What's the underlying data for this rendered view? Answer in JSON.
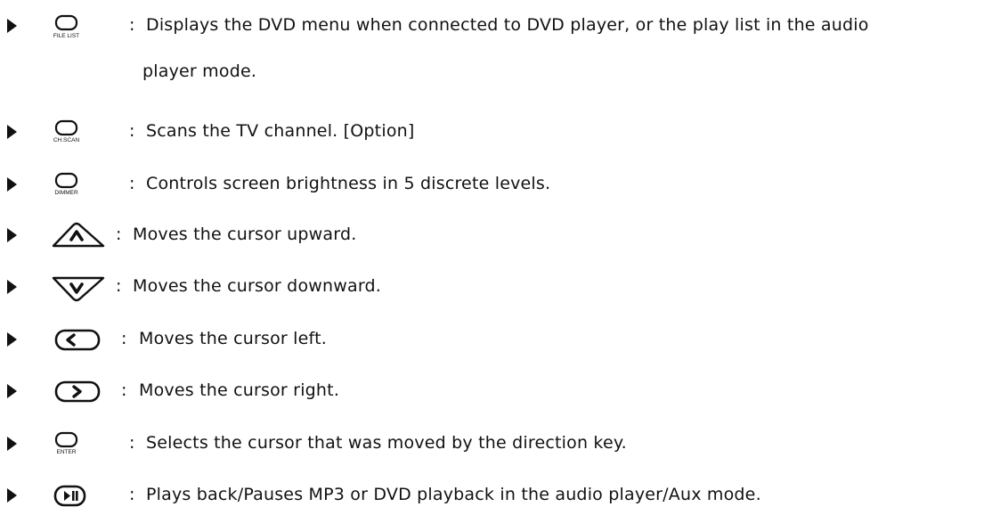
{
  "items": [
    {
      "icon": "file-list-button-icon",
      "key_label": "FILE LIST",
      "line1": "Displays the DVD menu when connected to DVD player, or the play list in the audio",
      "line2": "player mode."
    },
    {
      "icon": "ch-scan-button-icon",
      "key_label": "CH.SCAN",
      "line1": "Scans the TV channel. [Option]"
    },
    {
      "icon": "dimmer-button-icon",
      "key_label": "DIMMER",
      "line1": "Controls screen brightness in 5 discrete levels."
    },
    {
      "icon": "up-arrow-key-icon",
      "line1": "Moves the cursor upward."
    },
    {
      "icon": "down-arrow-key-icon",
      "line1": "Moves the cursor downward."
    },
    {
      "icon": "left-arrow-key-icon",
      "line1": "Moves the cursor left."
    },
    {
      "icon": "right-arrow-key-icon",
      "line1": "Moves the cursor right."
    },
    {
      "icon": "enter-button-icon",
      "key_label": "ENTER",
      "line1": "Selects the cursor that was moved by the direction key."
    },
    {
      "icon": "play-pause-button-icon",
      "line1": "Plays back/Pauses MP3 or DVD playback in the audio player/Aux mode."
    }
  ],
  "separator": ":"
}
